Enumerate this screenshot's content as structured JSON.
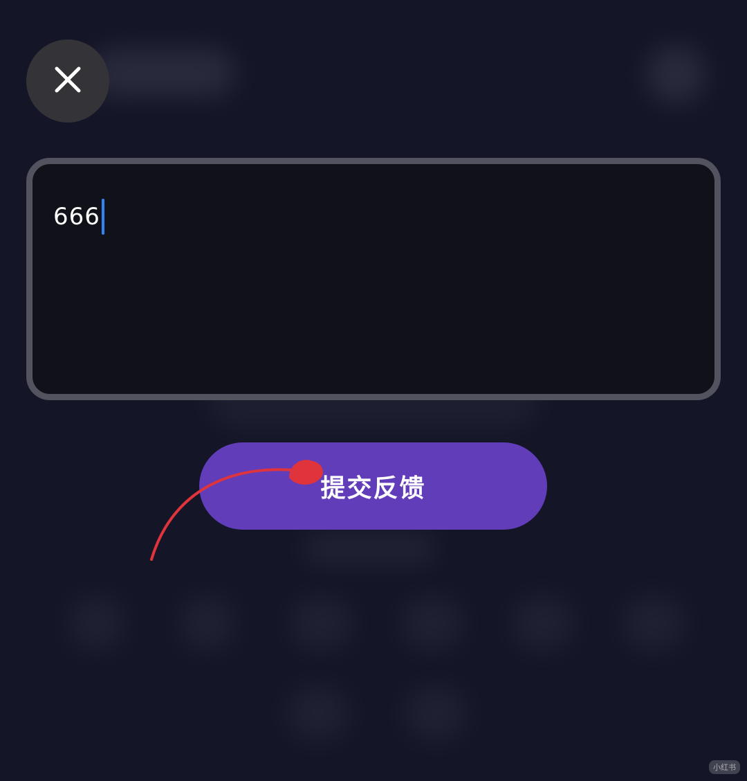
{
  "header": {
    "close_icon": "close-icon"
  },
  "feedback": {
    "text_value": "666"
  },
  "actions": {
    "submit_label": "提交反馈"
  },
  "annotation": {
    "arrow_color": "#e0343c"
  },
  "watermark": {
    "text": "小红书"
  },
  "colors": {
    "background": "#141628",
    "accent": "#613db9",
    "caret": "#2f86f0"
  }
}
